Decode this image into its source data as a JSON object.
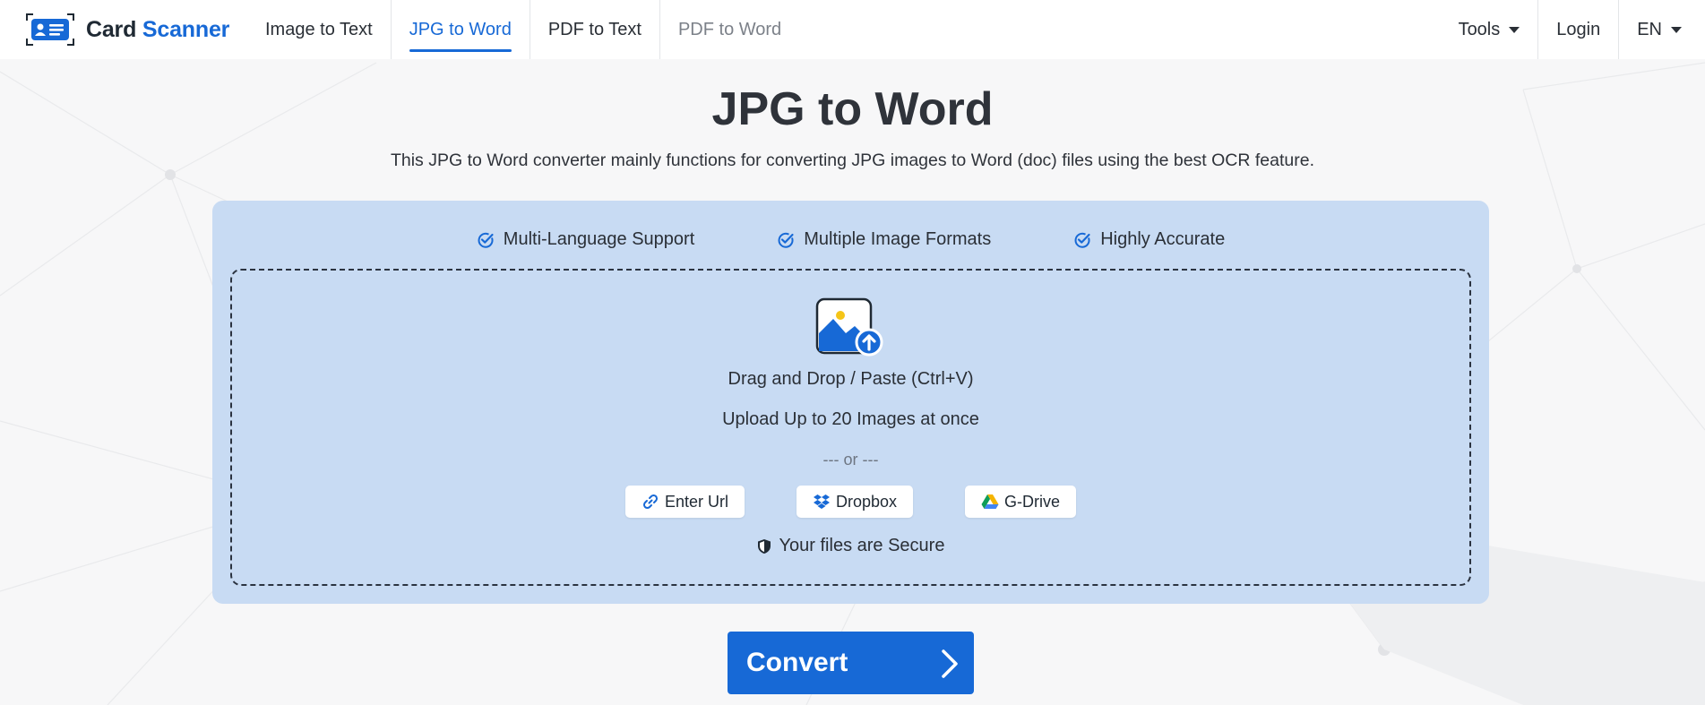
{
  "brand": {
    "name_part1": "Card",
    "name_part2": "Scanner"
  },
  "nav": {
    "items": [
      {
        "label": "Image to Text",
        "state": "normal"
      },
      {
        "label": "JPG to Word",
        "state": "active"
      },
      {
        "label": "PDF to Text",
        "state": "normal"
      },
      {
        "label": "PDF to Word",
        "state": "muted"
      }
    ],
    "tools_label": "Tools",
    "login_label": "Login",
    "language_label": "EN"
  },
  "hero": {
    "title": "JPG to Word",
    "subtitle": "This JPG to Word converter mainly functions for converting JPG images to Word (doc) files using the best OCR feature."
  },
  "features": [
    "Multi-Language Support",
    "Multiple Image Formats",
    "Highly Accurate"
  ],
  "dropzone": {
    "drag_text": "Drag and Drop / Paste (Ctrl+V)",
    "limit_text": "Upload Up to 20 Images at once",
    "or_text": "--- or ---",
    "buttons": {
      "url": "Enter Url",
      "dropbox": "Dropbox",
      "gdrive": "G-Drive"
    },
    "secure_text": "Your files are Secure"
  },
  "convert": {
    "label": "Convert"
  },
  "colors": {
    "accent": "#1769d6",
    "panel": "#c8dbf3",
    "text": "#2f333a"
  }
}
